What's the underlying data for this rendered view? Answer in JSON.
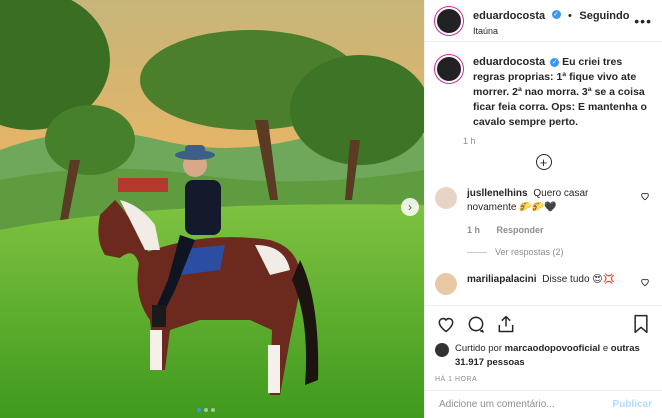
{
  "post": {
    "username": "eduardocosta",
    "verified_mark": "✓",
    "separator": "•",
    "follow_label": "Seguindo",
    "location": "Itaúna",
    "more_icon": "•••",
    "caption": "Eu criei tres regras proprias: 1ª fique vivo ate morrer. 2ª nao morra. 3ª se a coisa ficar feia corra. Ops: E mantenha o cavalo sempre perto.",
    "caption_time": "1 h",
    "load_more_icon": "+"
  },
  "comments": [
    {
      "username": "jusllenelhins",
      "text": "Quero casar novamente 🌮🌮🖤",
      "time": "1 h",
      "reply_label": "Responder",
      "replies_label": "Ver respostas (2)"
    },
    {
      "username": "mariliapalacini",
      "text": "Disse tudo 😍💢"
    }
  ],
  "likes": {
    "prefix": "Curtido por",
    "user": "marcaodopovooficial",
    "middle": "e",
    "others": "outras 31.917 pessoas"
  },
  "posted_time": "HÁ 1 HORA",
  "add_comment": {
    "placeholder": "Adicione um comentário...",
    "publish_label": "Publicar"
  },
  "carousel": {
    "next_icon": "›",
    "total": 3,
    "current": 1
  },
  "colors": {
    "accent": "#3897f0",
    "publish_disabled": "#b3dbff",
    "muted": "#8e8e8e"
  }
}
